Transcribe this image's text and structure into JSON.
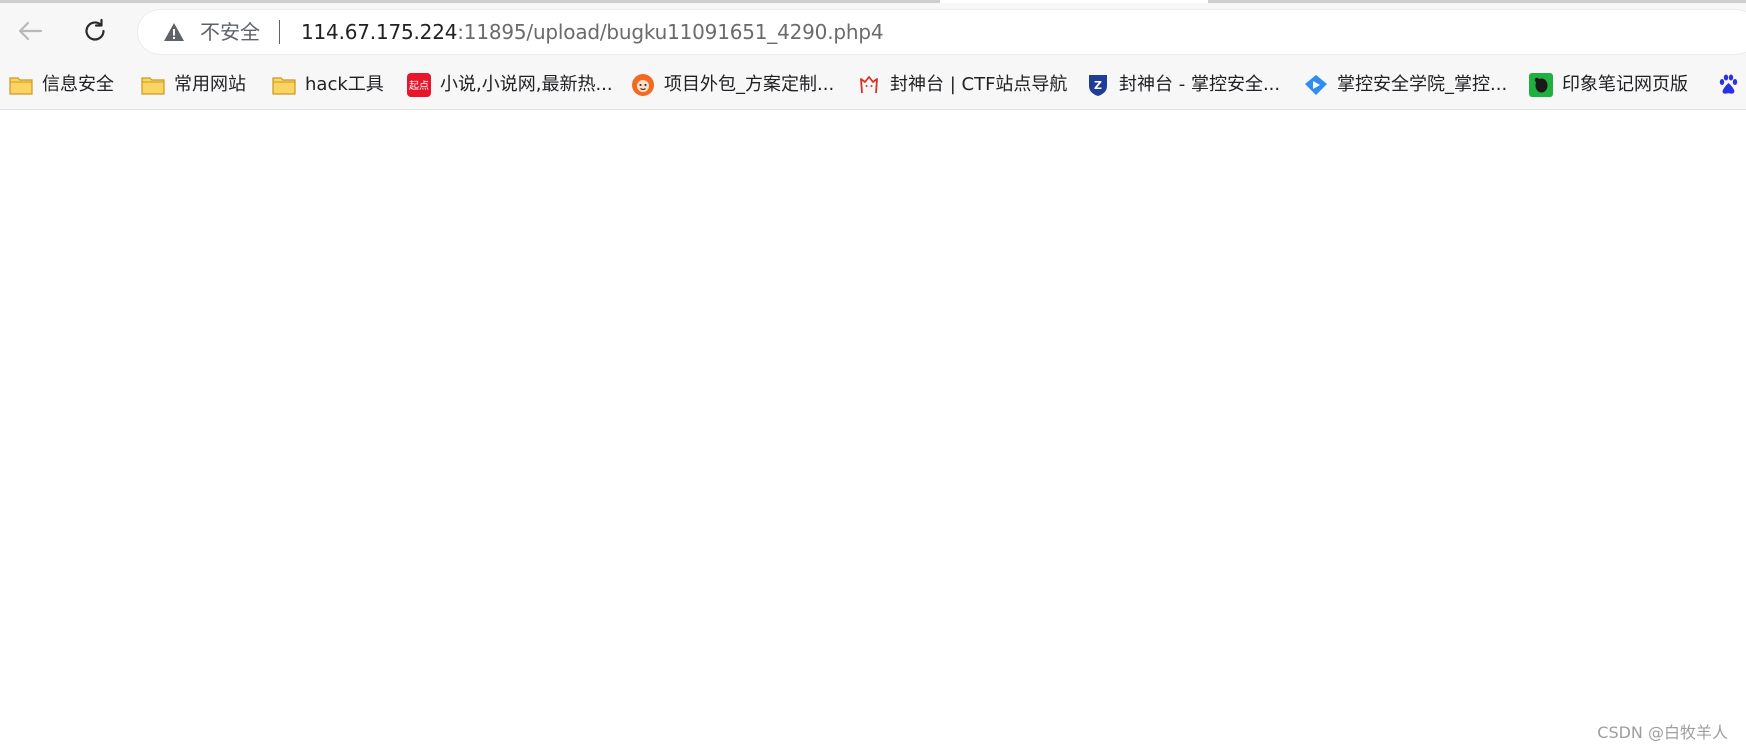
{
  "address_bar": {
    "security_label": "不安全",
    "url_host": "114.67.175.224",
    "url_path": ":11895/upload/bugku11091651_4290.php4"
  },
  "toolbar": {
    "back_icon": "arrow-left-icon",
    "reload_icon": "reload-icon",
    "security_icon": "warning-triangle-icon"
  },
  "bookmarks": [
    {
      "label": "信息安全",
      "icon": "folder-icon"
    },
    {
      "label": "常用网站",
      "icon": "folder-icon"
    },
    {
      "label": "hack工具",
      "icon": "folder-icon"
    },
    {
      "label": "小说,小说网,最新热...",
      "icon": "qidian-logo-icon",
      "icon_text": "起点"
    },
    {
      "label": "项目外包_方案定制...",
      "icon": "orange-monkey-icon"
    },
    {
      "label": "封神台 | CTF站点导航",
      "icon": "red-cat-icon"
    },
    {
      "label": "封神台 - 掌控安全...",
      "icon": "blue-shield-icon"
    },
    {
      "label": "掌控安全学院_掌控...",
      "icon": "blue-diamond-icon"
    },
    {
      "label": "印象笔记网页版",
      "icon": "evernote-icon"
    },
    {
      "label": "",
      "icon": "baidu-paw-icon"
    }
  ],
  "page": {
    "watermark": "CSDN @白牧羊人"
  },
  "colors": {
    "folder": "#f6c142",
    "qidian": "#e8162b",
    "orange": "#f26a21",
    "cat_red": "#d9302a",
    "shield_blue": "#1f3c98",
    "diamond_blue": "#2f8cf0",
    "evernote_green": "#1fb040",
    "baidu_blue": "#2932e1"
  }
}
